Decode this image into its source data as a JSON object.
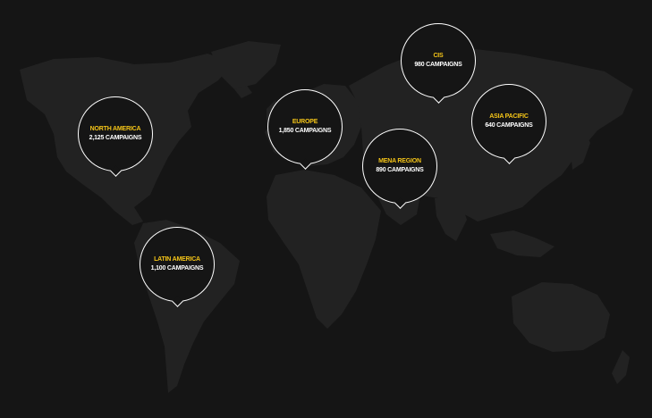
{
  "colors": {
    "background": "#151515",
    "land": "#222222",
    "accent": "#f5c518",
    "text": "#ffffff",
    "marker_border": "#ffffff"
  },
  "regions": [
    {
      "name": "NORTH AMERICA",
      "count": "2,125 CAMPAIGNS"
    },
    {
      "name": "EUROPE",
      "count": "1,850 CAMPAIGNS"
    },
    {
      "name": "CIS",
      "count": "980 CAMPAIGNS"
    },
    {
      "name": "ASIA PACIFIC",
      "count": "640 CAMPAIGNS"
    },
    {
      "name": "MENA REGION",
      "count": "890 CAMPAIGNS"
    },
    {
      "name": "LATIN AMERICA",
      "count": "1,100 CAMPAIGNS"
    }
  ]
}
